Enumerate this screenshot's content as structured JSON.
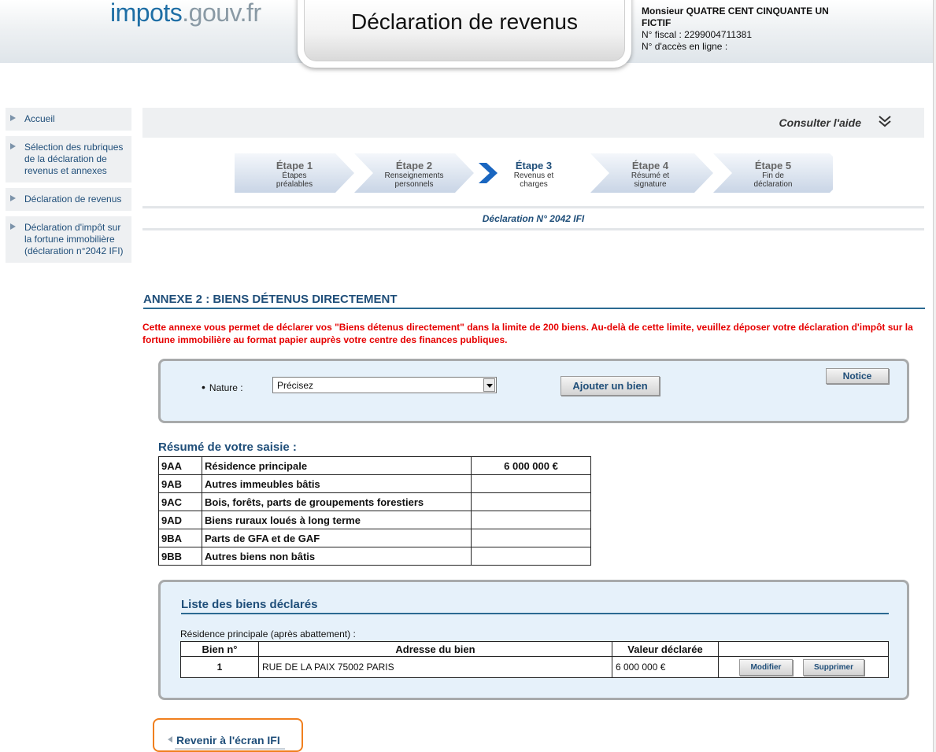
{
  "header": {
    "logo_main": "impots",
    "logo_gouv": ".gouv.fr",
    "title": "Déclaration de revenus",
    "user_name": "Monsieur QUATRE CENT CINQUANTE UN FICTIF",
    "fiscal_number": "N° fiscal : 2299004711381",
    "access_number": "N° d'accès en ligne :"
  },
  "sidebar": {
    "items": [
      {
        "label": "Accueil"
      },
      {
        "label": "Sélection des rubriques de la déclaration de revenus et annexes"
      },
      {
        "label": "Déclaration de revenus"
      },
      {
        "label": "Déclaration d'impôt sur la fortune immobilière (déclaration n°2042 IFI)"
      }
    ]
  },
  "help": {
    "label": "Consulter l'aide",
    "icon": "double-chevron-down-icon"
  },
  "steps": [
    {
      "title": "Étape 1",
      "subtitle": "Étapes préalables",
      "active": false
    },
    {
      "title": "Étape 2",
      "subtitle": "Renseignements personnels",
      "active": false
    },
    {
      "title": "Étape 3",
      "subtitle": "Revenus et charges",
      "active": true
    },
    {
      "title": "Étape 4",
      "subtitle": "Résumé et signature",
      "active": false
    },
    {
      "title": "Étape 5",
      "subtitle": "Fin de déclaration",
      "active": false
    }
  ],
  "declaration_number": "Déclaration N° 2042 IFI",
  "annex": {
    "title": "ANNEXE 2 : BIENS DÉTENUS DIRECTEMENT",
    "note": "Cette annexe vous permet de déclarer vos \"Biens détenus directement\" dans la limite de 200 biens. Au-delà de cette limite, veuillez déposer votre déclaration d'impôt sur la fortune immobilière au format papier auprès votre centre des finances publiques."
  },
  "form": {
    "nature_label": "Nature :",
    "nature_value": "Précisez",
    "add_button": "Ajouter un bien",
    "notice_button": "Notice"
  },
  "resume": {
    "title": "Résumé de votre saisie :",
    "rows": [
      {
        "code": "9AA",
        "label": "Résidence principale",
        "amount": "6 000 000 €"
      },
      {
        "code": "9AB",
        "label": "Autres immeubles bâtis",
        "amount": ""
      },
      {
        "code": "9AC",
        "label": "Bois, forêts, parts de groupements forestiers",
        "amount": ""
      },
      {
        "code": "9AD",
        "label": "Biens ruraux loués à long terme",
        "amount": ""
      },
      {
        "code": "9BA",
        "label": "Parts de GFA et de GAF",
        "amount": ""
      },
      {
        "code": "9BB",
        "label": "Autres biens non bâtis",
        "amount": ""
      }
    ]
  },
  "biens": {
    "title": "Liste des biens déclarés",
    "section_label": "Résidence principale (après abattement) :",
    "headers": [
      "Bien n°",
      "Adresse du bien",
      "Valeur déclarée",
      ""
    ],
    "rows": [
      {
        "num": "1",
        "address": "RUE DE LA PAIX 75002 PARIS",
        "value": "6 000 000 €",
        "modify": "Modifier",
        "delete": "Supprimer"
      }
    ]
  },
  "back_button": "Revenir à l'écran IFI",
  "colors": {
    "accent": "#1f4e79",
    "warning": "#e60000",
    "box_bg": "#e6f1fa",
    "back_border": "#f07f1e"
  }
}
